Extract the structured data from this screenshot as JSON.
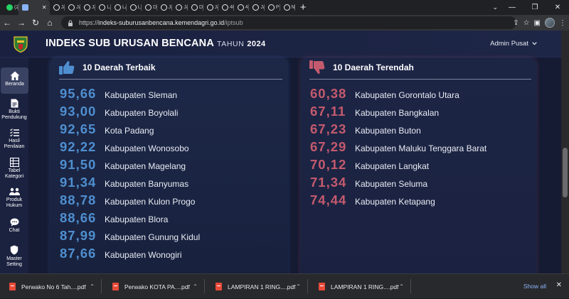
{
  "browser": {
    "tabs": [
      {
        "icon": "whatsapp-icon",
        "label": "(2"
      },
      {
        "icon": "kemendagri-icon",
        "label": "",
        "active": true
      },
      {
        "icon": "globe-icon",
        "label": "Ja"
      },
      {
        "icon": "globe-icon",
        "label": "Ja"
      },
      {
        "icon": "globe-icon",
        "label": "Ja"
      },
      {
        "icon": "globe-icon",
        "label": "LA"
      },
      {
        "icon": "globe-icon",
        "label": "LA"
      },
      {
        "icon": "globe-icon",
        "label": "LA"
      },
      {
        "icon": "globe-icon",
        "label": "D("
      },
      {
        "icon": "globe-icon",
        "label": "Ja"
      },
      {
        "icon": "globe-icon",
        "label": "Ja"
      },
      {
        "icon": "globe-icon",
        "label": "Dc"
      },
      {
        "icon": "globe-icon",
        "label": "Ja"
      },
      {
        "icon": "globe-icon",
        "label": "40"
      },
      {
        "icon": "globe-icon",
        "label": "40"
      },
      {
        "icon": "globe-icon",
        "label": "Ja"
      },
      {
        "icon": "globe-icon",
        "label": "PE"
      },
      {
        "icon": "globe-icon",
        "label": "N"
      }
    ],
    "new_tab": "+",
    "url_host": "indeks-suburusanbencana.kemendagri.go.id",
    "url_path": "/iptsub"
  },
  "header": {
    "title": "INDEKS SUB URUSAN BENCANA",
    "tahun_label": "TAHUN",
    "year": "2024",
    "user": "Admin Pusat"
  },
  "sidebar": {
    "items": [
      {
        "label": "Beranda",
        "icon": "home-icon"
      },
      {
        "label": "Bukti Pendukung",
        "icon": "document-icon"
      },
      {
        "label": "Hasil Penilaian",
        "icon": "list-icon"
      },
      {
        "label": "Tabel Kategori",
        "icon": "table-icon"
      },
      {
        "label": "Produk Hukum",
        "icon": "people-icon"
      },
      {
        "label": "Chat",
        "icon": "chat-icon"
      },
      {
        "label": "Master Setting",
        "icon": "shield-icon"
      }
    ]
  },
  "best": {
    "title": "10 Daerah Terbaik",
    "rows": [
      {
        "score": "95,66",
        "region": "Kabupaten Sleman"
      },
      {
        "score": "93,00",
        "region": "Kabupaten Boyolali"
      },
      {
        "score": "92,65",
        "region": "Kota Padang"
      },
      {
        "score": "92,22",
        "region": "Kabupaten Wonosobo"
      },
      {
        "score": "91,50",
        "region": "Kabupaten Magelang"
      },
      {
        "score": "91,34",
        "region": "Kabupaten Banyumas"
      },
      {
        "score": "88,78",
        "region": "Kabupaten Kulon Progo"
      },
      {
        "score": "88,66",
        "region": "Kabupaten Blora"
      },
      {
        "score": "87,99",
        "region": "Kabupaten Gunung Kidul"
      },
      {
        "score": "87,66",
        "region": "Kabupaten Wonogiri"
      }
    ]
  },
  "worst": {
    "title": "10 Daerah Terendah",
    "rows": [
      {
        "score": "60,38",
        "region": "Kabupaten Gorontalo Utara"
      },
      {
        "score": "67,11",
        "region": "Kabupaten Bangkalan"
      },
      {
        "score": "67,23",
        "region": "Kabupaten Buton"
      },
      {
        "score": "67,29",
        "region": "Kabupaten Maluku Tenggara Barat"
      },
      {
        "score": "70,12",
        "region": "Kabupaten Langkat"
      },
      {
        "score": "71,34",
        "region": "Kabupaten Seluma"
      },
      {
        "score": "74,44",
        "region": "Kabupaten Ketapang"
      }
    ]
  },
  "downloads": {
    "items": [
      {
        "name": "Perwako No 6 Tah....pdf"
      },
      {
        "name": "Perwako KOTA PA....pdf"
      },
      {
        "name": "LAMPIRAN 1 RING....pdf"
      },
      {
        "name": "LAMPIRAN 1 RING....pdf"
      }
    ],
    "show_all": "Show all"
  },
  "colors": {
    "best_score": "#4f8fd0",
    "worst_score": "#c45a6e",
    "page_bg": "#151b33"
  }
}
